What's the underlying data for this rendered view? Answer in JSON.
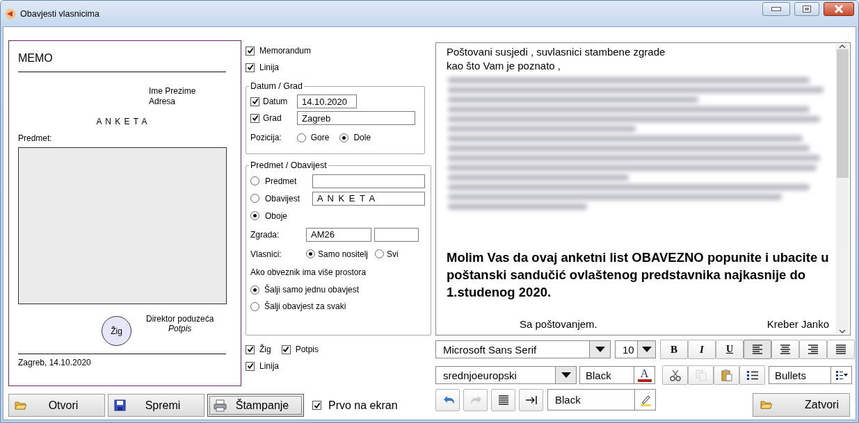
{
  "window": {
    "title": "Obavjesti vlasnicima"
  },
  "preview": {
    "header": "MEMO",
    "recipient": [
      "Ime Prezime",
      "Adresa"
    ],
    "heading": "A N K E T A",
    "subject_label": "Predmet:",
    "stamp": "Žig",
    "signer": "Direktor poduzeća",
    "signature": "Potpis",
    "footer": "Zagreb, 14.10.2020"
  },
  "options": {
    "top_checks": [
      {
        "label": "Memorandum",
        "checked": true
      },
      {
        "label": "Linija",
        "checked": true
      }
    ],
    "date_city": {
      "title": "Datum / Grad",
      "fields": [
        {
          "label": "Datum",
          "checked": true,
          "value": "14.10.2020"
        },
        {
          "label": "Grad",
          "checked": true,
          "value": "Zagreb"
        }
      ],
      "position_label": "Pozicija:",
      "positions": [
        {
          "label": "Gore",
          "selected": false
        },
        {
          "label": "Dole",
          "selected": true
        }
      ]
    },
    "subject": {
      "title": "Predmet / Obavijest",
      "choices": [
        {
          "label": "Predmet",
          "selected": false,
          "kind": "field"
        },
        {
          "label": "Obavijest",
          "selected": false,
          "kind": "field",
          "value": "A N K E T A"
        },
        {
          "label": "Oboje",
          "selected": true,
          "kind": "plain"
        }
      ],
      "building_label": "Zgrada:",
      "building": "AM26",
      "owners_label": "Vlasnici:",
      "owners": [
        {
          "label": "Samo nositelj",
          "selected": true
        },
        {
          "label": "Svi",
          "selected": false
        }
      ],
      "multi_label": "Ako obveznik ima više prostora",
      "multi": [
        {
          "label": "Šalji samo jednu obavjest",
          "selected": true
        },
        {
          "label": "Šalji obavjest za svaki",
          "selected": false
        }
      ]
    },
    "bottom_checks": [
      {
        "label": "Žig",
        "checked": true
      },
      {
        "label": "Potpis",
        "checked": true
      },
      {
        "label": "Linija",
        "checked": true
      }
    ]
  },
  "buttons": [
    {
      "label": "Otvori",
      "kind": "open",
      "focused": false
    },
    {
      "label": "Spremi",
      "kind": "save",
      "focused": false
    },
    {
      "label": "Štampanje",
      "kind": "print",
      "focused": true
    }
  ],
  "print_first": {
    "label": "Prvo na ekran",
    "checked": true
  },
  "editor": {
    "lines": [
      "Poštovani susjedi , suvlasnici stambene zgrade",
      "kao što Vam je poznato ,"
    ],
    "notice": "Molim Vas da ovaj anketni list OBAVEZNO popunite i ubacite u poštanski sandučić ovlaštenog predstavnika najkasnije do 1.studenog 2020.",
    "closing": "Sa poštovanjem.",
    "sender": "Kreber Janko"
  },
  "toolbar": {
    "font": "Microsoft Sans Serif",
    "size": "10",
    "styles": [
      {
        "kind": "bold",
        "glyph": "B"
      },
      {
        "kind": "italic",
        "glyph": "I"
      },
      {
        "kind": "underline",
        "glyph": "U"
      }
    ],
    "alignment": [
      {
        "kind": "left",
        "selected": true
      },
      {
        "kind": "center",
        "selected": false
      },
      {
        "kind": "right",
        "selected": false
      },
      {
        "kind": "justify",
        "selected": false
      }
    ],
    "charset": "srednjoeuropski",
    "text_color": "Black",
    "text_color_glyph": "A",
    "edit_tools": [
      {
        "kind": "cut",
        "disabled": false
      },
      {
        "kind": "copy",
        "disabled": true
      },
      {
        "kind": "paste",
        "disabled": false
      },
      {
        "kind": "list",
        "disabled": false
      }
    ],
    "list_style": "Bullets",
    "history_tools": [
      {
        "kind": "undo",
        "disabled": false
      },
      {
        "kind": "redo",
        "disabled": true
      },
      {
        "kind": "paragraph",
        "disabled": false
      },
      {
        "kind": "indent",
        "disabled": false
      }
    ],
    "highlight_color": "Black"
  },
  "close_button": {
    "label": "Zatvori"
  }
}
